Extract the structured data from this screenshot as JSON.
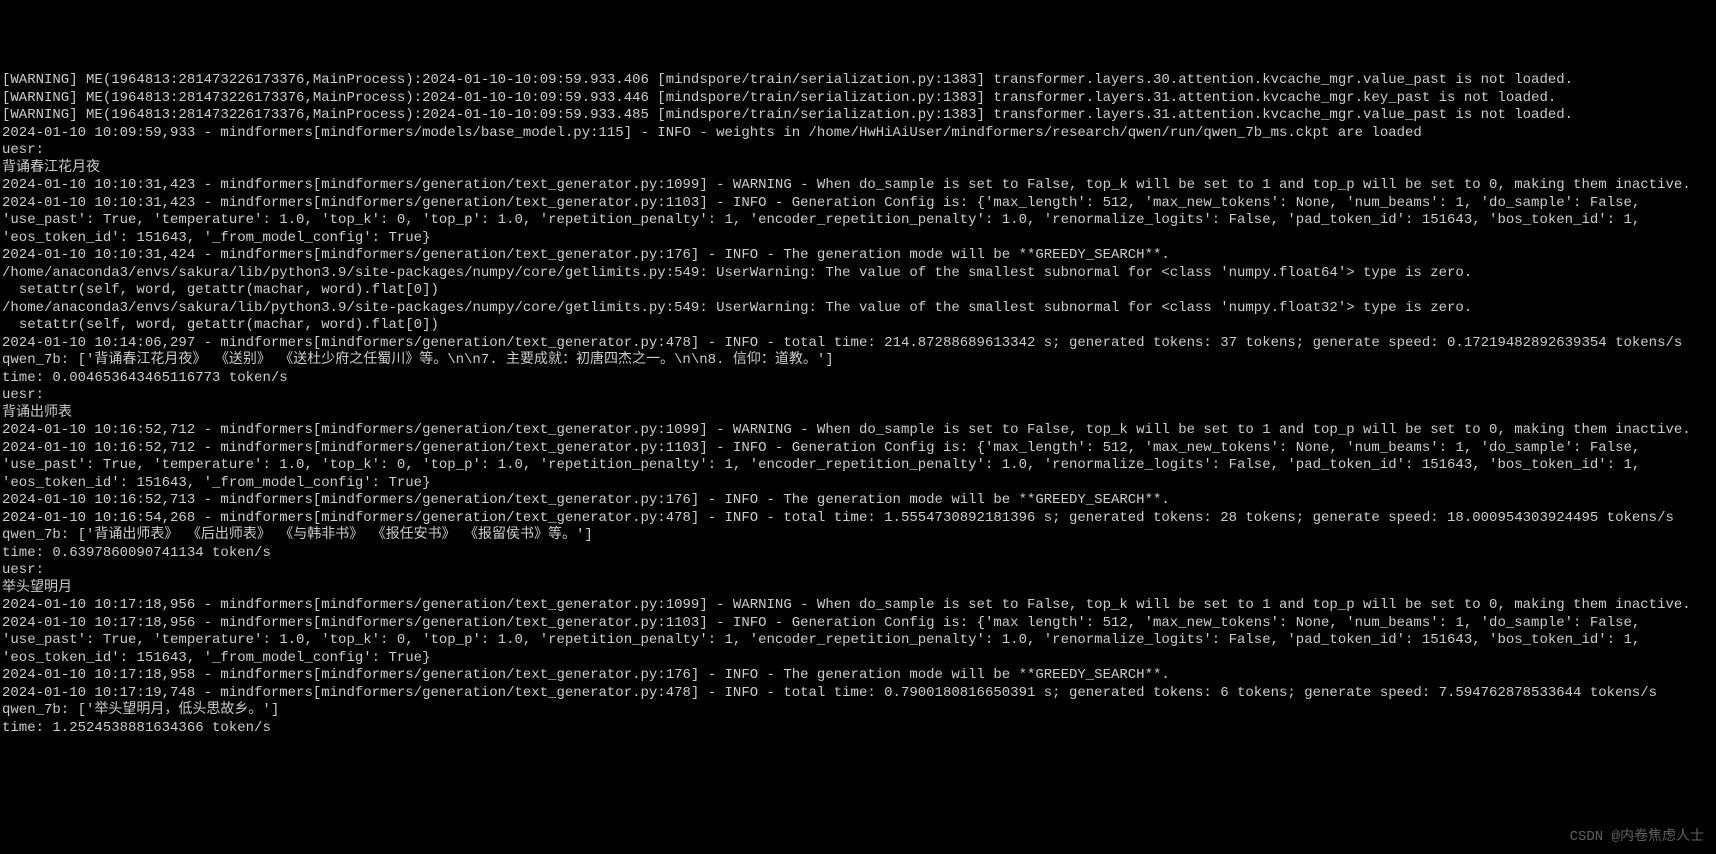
{
  "lines": [
    "[WARNING] ME(1964813:281473226173376,MainProcess):2024-01-10-10:09:59.933.406 [mindspore/train/serialization.py:1383] transformer.layers.30.attention.kvcache_mgr.value_past is not loaded.",
    "[WARNING] ME(1964813:281473226173376,MainProcess):2024-01-10-10:09:59.933.446 [mindspore/train/serialization.py:1383] transformer.layers.31.attention.kvcache_mgr.key_past is not loaded.",
    "[WARNING] ME(1964813:281473226173376,MainProcess):2024-01-10-10:09:59.933.485 [mindspore/train/serialization.py:1383] transformer.layers.31.attention.kvcache_mgr.value_past is not loaded.",
    "2024-01-10 10:09:59,933 - mindformers[mindformers/models/base_model.py:115] - INFO - weights in /home/HwHiAiUser/mindformers/research/qwen/run/qwen_7b_ms.ckpt are loaded",
    "uesr:",
    "背诵春江花月夜",
    "2024-01-10 10:10:31,423 - mindformers[mindformers/generation/text_generator.py:1099] - WARNING - When do_sample is set to False, top_k will be set to 1 and top_p will be set to 0, making them inactive.",
    "2024-01-10 10:10:31,423 - mindformers[mindformers/generation/text_generator.py:1103] - INFO - Generation Config is: {'max_length': 512, 'max_new_tokens': None, 'num_beams': 1, 'do_sample': False, 'use_past': True, 'temperature': 1.0, 'top_k': 0, 'top_p': 1.0, 'repetition_penalty': 1, 'encoder_repetition_penalty': 1.0, 'renormalize_logits': False, 'pad_token_id': 151643, 'bos_token_id': 1, 'eos_token_id': 151643, '_from_model_config': True}",
    "2024-01-10 10:10:31,424 - mindformers[mindformers/generation/text_generator.py:176] - INFO - The generation mode will be **GREEDY_SEARCH**.",
    "/home/anaconda3/envs/sakura/lib/python3.9/site-packages/numpy/core/getlimits.py:549: UserWarning: The value of the smallest subnormal for <class 'numpy.float64'> type is zero.",
    "  setattr(self, word, getattr(machar, word).flat[0])",
    "/home/anaconda3/envs/sakura/lib/python3.9/site-packages/numpy/core/getlimits.py:549: UserWarning: The value of the smallest subnormal for <class 'numpy.float32'> type is zero.",
    "  setattr(self, word, getattr(machar, word).flat[0])",
    "2024-01-10 10:14:06,297 - mindformers[mindformers/generation/text_generator.py:478] - INFO - total time: 214.87288689613342 s; generated tokens: 37 tokens; generate speed: 0.17219482892639354 tokens/s",
    "qwen_7b: ['背诵春江花月夜》 《送别》 《送杜少府之任蜀川》等。\\n\\n7. 主要成就：初唐四杰之一。\\n\\n8. 信仰：道教。']",
    "time: 0.004653643465116773 token/s",
    "uesr:",
    "背诵出师表",
    "2024-01-10 10:16:52,712 - mindformers[mindformers/generation/text_generator.py:1099] - WARNING - When do_sample is set to False, top_k will be set to 1 and top_p will be set to 0, making them inactive.",
    "2024-01-10 10:16:52,712 - mindformers[mindformers/generation/text_generator.py:1103] - INFO - Generation Config is: {'max_length': 512, 'max_new_tokens': None, 'num_beams': 1, 'do_sample': False, 'use_past': True, 'temperature': 1.0, 'top_k': 0, 'top_p': 1.0, 'repetition_penalty': 1, 'encoder_repetition_penalty': 1.0, 'renormalize_logits': False, 'pad_token_id': 151643, 'bos_token_id': 1, 'eos_token_id': 151643, '_from_model_config': True}",
    "2024-01-10 10:16:52,713 - mindformers[mindformers/generation/text_generator.py:176] - INFO - The generation mode will be **GREEDY_SEARCH**.",
    "2024-01-10 10:16:54,268 - mindformers[mindformers/generation/text_generator.py:478] - INFO - total time: 1.5554730892181396 s; generated tokens: 28 tokens; generate speed: 18.000954303924495 tokens/s",
    "qwen_7b: ['背诵出师表》 《后出师表》 《与韩非书》 《报任安书》 《报留侯书》等。']",
    "time: 0.6397860090741134 token/s",
    "uesr:",
    "举头望明月",
    "2024-01-10 10:17:18,956 - mindformers[mindformers/generation/text_generator.py:1099] - WARNING - When do_sample is set to False, top_k will be set to 1 and top_p will be set to 0, making them inactive.",
    "2024-01-10 10:17:18,956 - mindformers[mindformers/generation/text_generator.py:1103] - INFO - Generation Config is: {'max length': 512, 'max_new_tokens': None, 'num_beams': 1, 'do_sample': False, 'use_past': True, 'temperature': 1.0, 'top_k': 0, 'top_p': 1.0, 'repetition_penalty': 1, 'encoder_repetition_penalty': 1.0, 'renormalize_logits': False, 'pad_token_id': 151643, 'bos_token_id': 1, 'eos_token_id': 151643, '_from_model_config': True}",
    "2024-01-10 10:17:18,958 - mindformers[mindformers/generation/text_generator.py:176] - INFO - The generation mode will be **GREEDY_SEARCH**.",
    "2024-01-10 10:17:19,748 - mindformers[mindformers/generation/text_generator.py:478] - INFO - total time: 0.7900180816650391 s; generated tokens: 6 tokens; generate speed: 7.594762878533644 tokens/s",
    "qwen_7b: ['举头望明月，低头思故乡。']",
    "time: 1.2524538881634366 token/s"
  ],
  "watermark": "CSDN @内卷焦虑人士"
}
